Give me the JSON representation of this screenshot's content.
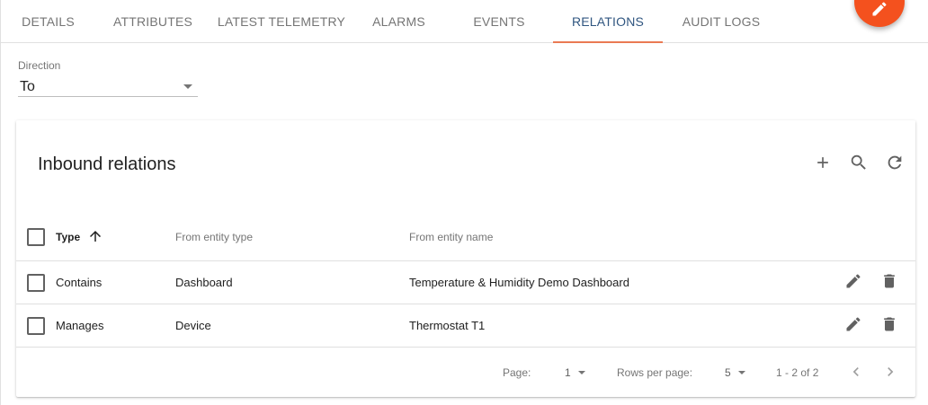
{
  "tabs": [
    {
      "label": "DETAILS",
      "active": false
    },
    {
      "label": "ATTRIBUTES",
      "active": false
    },
    {
      "label": "LATEST TELEMETRY",
      "active": false
    },
    {
      "label": "ALARMS",
      "active": false
    },
    {
      "label": "EVENTS",
      "active": false
    },
    {
      "label": "RELATIONS",
      "active": true
    },
    {
      "label": "AUDIT LOGS",
      "active": false
    }
  ],
  "fab": {
    "icon": "edit-icon",
    "color": "#f4511e"
  },
  "direction": {
    "label": "Direction",
    "value": "To"
  },
  "card": {
    "title": "Inbound relations",
    "actions": [
      "add-icon",
      "search-icon",
      "refresh-icon"
    ]
  },
  "table": {
    "columns": {
      "type": "Type",
      "from_entity_type": "From entity type",
      "from_entity_name": "From entity name"
    },
    "sort_icon": "arrow-upward-icon",
    "rows": [
      {
        "type": "Contains",
        "from_entity_type": "Dashboard",
        "from_entity_name": "Temperature & Humidity Demo Dashboard"
      },
      {
        "type": "Manages",
        "from_entity_type": "Device",
        "from_entity_name": "Thermostat T1"
      }
    ]
  },
  "paginator": {
    "page_label": "Page:",
    "page_value": "1",
    "rows_label": "Rows per page:",
    "rows_value": "5",
    "range": "1 - 2 of 2"
  },
  "colors": {
    "accent": "#305680",
    "tab_indicator": "#ea7a53",
    "fab": "#f4511e"
  }
}
